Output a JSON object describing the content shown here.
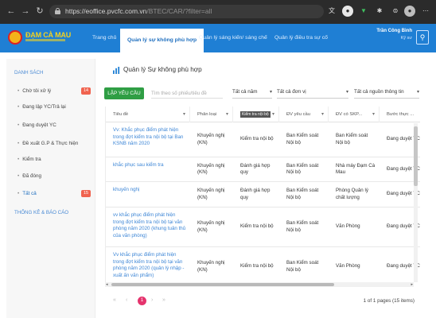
{
  "browser": {
    "url_host": "https://eoffice.pvcfc.com.vn",
    "url_path": "/BTEC/CAR/?filter=all"
  },
  "header": {
    "logo_text": "ĐẠM CÀ MAU",
    "nav": [
      {
        "label": "Trang chủ"
      },
      {
        "label": "Quản lý sự không phù hợp"
      },
      {
        "label": "Quản lý sáng kiến/ sáng chế"
      },
      {
        "label": "Quản lý điều tra sự cố"
      }
    ],
    "user_name": "Trần Công Bình",
    "user_role": "Kỹ sư"
  },
  "sidebar": {
    "section1": "DANH SÁCH",
    "items": [
      {
        "label": "Chờ tôi xử lý",
        "badge": "14"
      },
      {
        "label": "Đang lập YC/Trả lại",
        "badge": ""
      },
      {
        "label": "Đang duyệt YC",
        "badge": ""
      },
      {
        "label": "Đề xuất G.P & Thực hiện",
        "badge": ""
      },
      {
        "label": "Kiểm tra",
        "badge": ""
      },
      {
        "label": "Đã đóng",
        "badge": ""
      },
      {
        "label": "Tất cả",
        "badge": "15"
      }
    ],
    "section2": "THỐNG KÊ & BÁO CÁO"
  },
  "main": {
    "title": "Quản lý Sự không phù hợp",
    "create_button": "LẬP YÊU CẦU",
    "search_placeholder": "Tìm theo số phiếu/tiêu đề",
    "filters": [
      {
        "label": "Tất cả năm"
      },
      {
        "label": "Tất cả đơn vị"
      },
      {
        "label": "Tất cả nguồn thông tin"
      }
    ]
  },
  "table": {
    "columns": [
      "Tiêu đề",
      "Phân loại",
      "Kiểm tra nội bộ",
      "ĐV yêu cầu",
      "ĐV có SKP...",
      "Bước thực ..."
    ],
    "rows": [
      [
        "Vv: Khắc phục điểm phát hiện trong đợt kiểm tra nội bộ tại Ban KSNB năm 2020",
        "Khuyến nghị (KN)",
        "Kiểm tra nội bộ",
        "Ban Kiểm soát Nội bộ",
        "Ban Kiểm soát Nội bộ",
        "Đang duyệt YC"
      ],
      [
        "khắc phục sau kiểm tra",
        "Khuyến nghị (KN)",
        "Đánh giá hợp quy",
        "Ban Kiểm soát Nội bộ",
        "Nhà máy Đạm Cà Mau",
        "Đang duyệt YC"
      ],
      [
        "khuyến nghị",
        "Khuyến nghị (KN)",
        "Đánh giá hợp quy",
        "Ban Kiểm soát Nội bộ",
        "Phòng Quản lý chất lượng",
        "Đang duyệt YC"
      ],
      [
        "vv khắc phục điểm phát hiện trong đợt kiểm tra nội bộ tại văn phòng năm 2020 (khung tuân thủ của văn phòng)",
        "Khuyến nghị (KN)",
        "Kiểm tra nội bộ",
        "Ban Kiểm soát Nội bộ",
        "Văn Phòng",
        "Đang duyệt YC"
      ],
      [
        "Vv khắc phục điểm phát hiện trong đợt kiểm tra nội bộ tại văn phòng năm 2020 (quản lý nhập - xuất ấn văn phẩm)",
        "Khuyến nghị (KN)",
        "Kiểm tra nội bộ",
        "Ban Kiểm soát Nội bộ",
        "Văn Phòng",
        "Đang duyệt YC"
      ]
    ]
  },
  "pagination": {
    "current_page": "1",
    "info": "1 of 1 pages (15 items)"
  }
}
